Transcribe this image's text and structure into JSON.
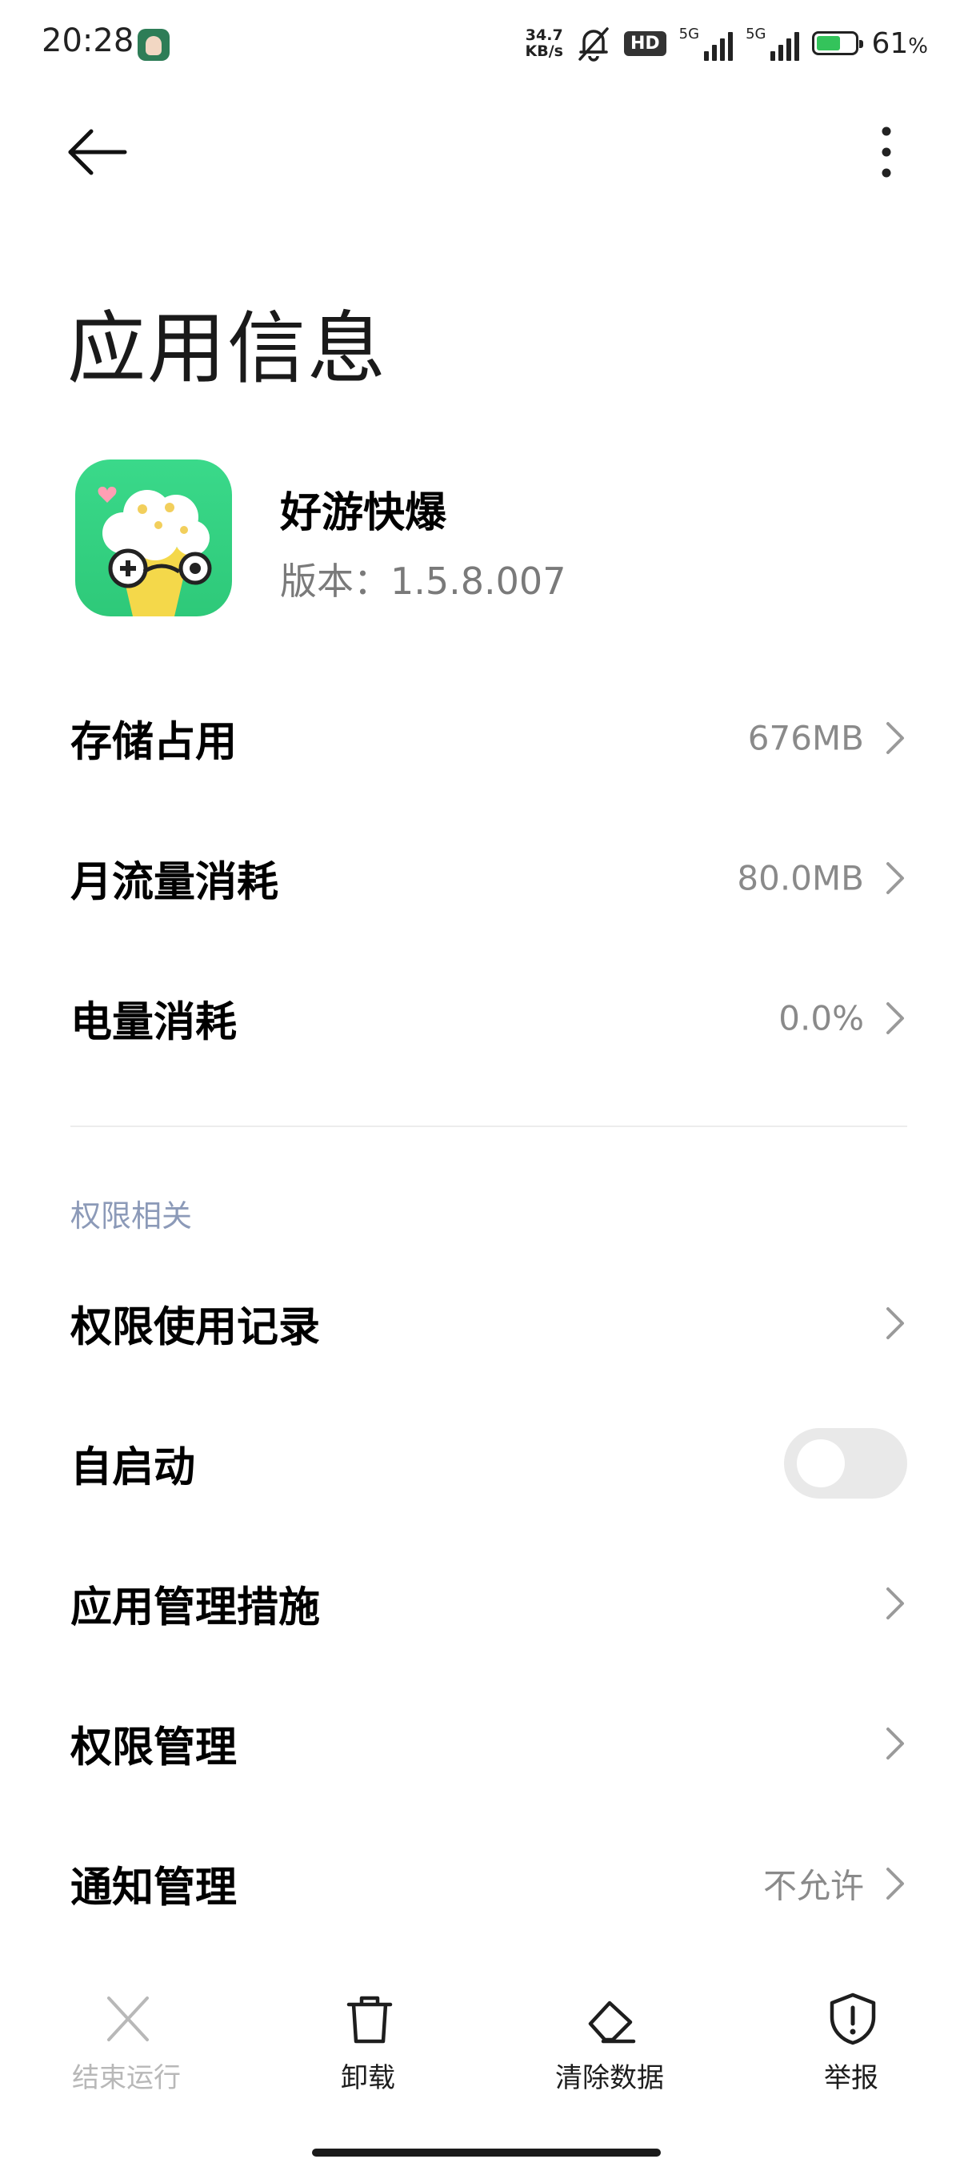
{
  "status_bar": {
    "time": "20:28",
    "net_speed_value": "34.7",
    "net_speed_unit": "KB/s",
    "hd_badge": "HD",
    "network_1": "5G",
    "network_2": "5G",
    "battery_level": 0.61,
    "battery_percent": "61",
    "battery_percent_sign": "%",
    "battery_color": "#34c35b"
  },
  "header": {
    "back_icon": "arrow-left-icon",
    "more_icon": "more-vertical-icon",
    "title": "应用信息"
  },
  "app": {
    "icon": "popcorn-game-icon",
    "name": "好游快爆",
    "version": "版本：1.5.8.007"
  },
  "usage_items": [
    {
      "label": "存储占用",
      "value": "676MB"
    },
    {
      "label": "月流量消耗",
      "value": "80.0MB"
    },
    {
      "label": "电量消耗",
      "value": "0.0%"
    }
  ],
  "permissions_section": {
    "header": "权限相关",
    "items": [
      {
        "label": "权限使用记录",
        "value": ""
      },
      {
        "label": "自启动",
        "toggle_on": false
      },
      {
        "label": "应用管理措施",
        "value": ""
      },
      {
        "label": "权限管理",
        "value": ""
      },
      {
        "label": "通知管理",
        "value": "不允许"
      }
    ]
  },
  "bottom_actions": [
    {
      "label": "结束运行",
      "icon": "close-icon",
      "enabled": false
    },
    {
      "label": "卸载",
      "icon": "trash-icon",
      "enabled": true
    },
    {
      "label": "清除数据",
      "icon": "eraser-icon",
      "enabled": true
    },
    {
      "label": "举报",
      "icon": "shield-alert-icon",
      "enabled": true
    }
  ],
  "colors": {
    "accent_section": "#8c9ab8",
    "value_text": "#8a8a8a",
    "disabled_text": "#b8b8b8",
    "toggle_off": "#e9e9e9"
  }
}
